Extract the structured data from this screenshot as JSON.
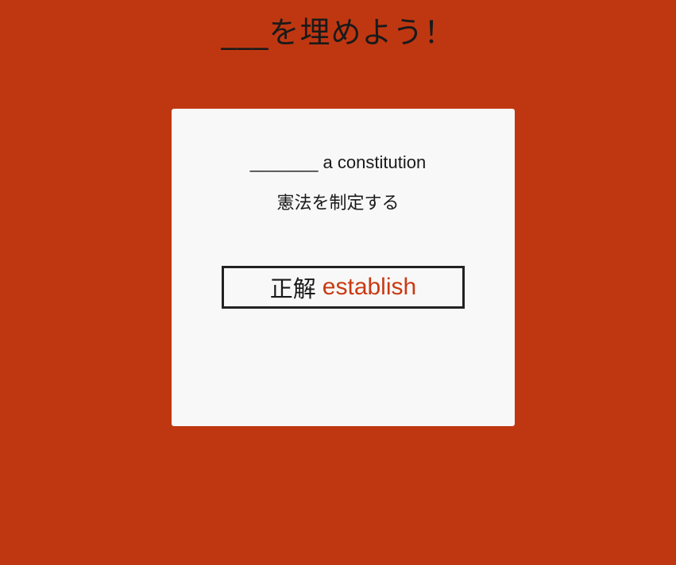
{
  "heading": "___を埋めよう！",
  "quiz": {
    "question": "_______ a constitution",
    "translation": "憲法を制定する",
    "answer_label": "正解",
    "answer_word": "establish"
  },
  "colors": {
    "background": "#bf3711",
    "card": "#f8f8f8",
    "answer_accent": "#c93a12",
    "text": "#1a1a1a"
  }
}
